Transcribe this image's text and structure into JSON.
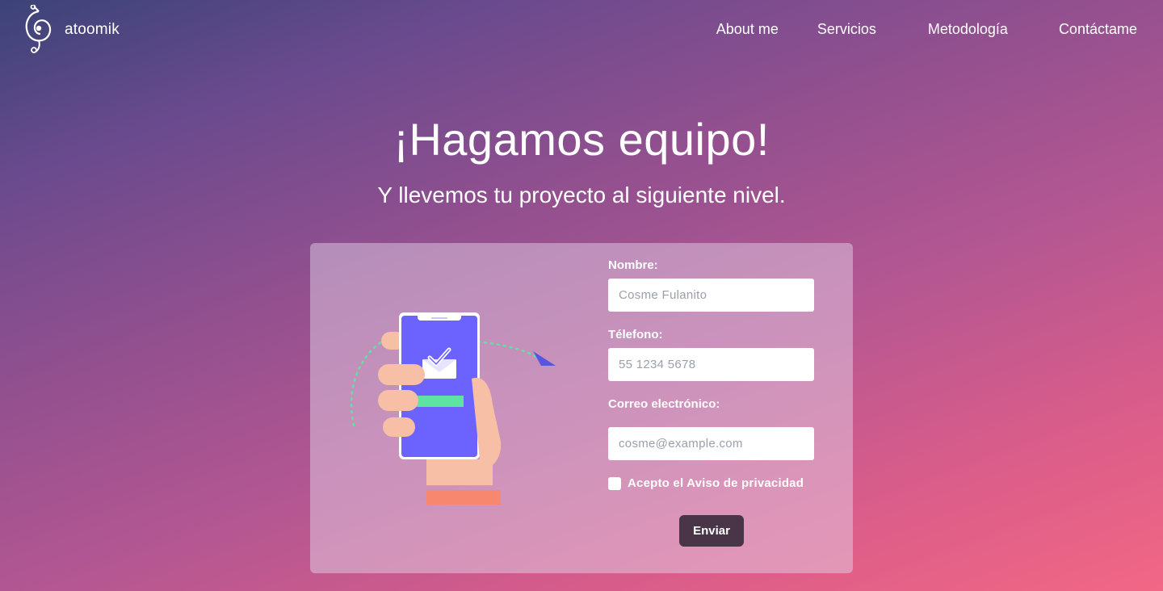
{
  "brand": {
    "name": "atoomik",
    "logo_icon": "atom-spiral-icon"
  },
  "nav": {
    "items": [
      {
        "label": "About me"
      },
      {
        "label": "Servicios"
      },
      {
        "label": "Metodología"
      },
      {
        "label": "Contáctame"
      }
    ]
  },
  "hero": {
    "title": "¡Hagamos equipo!",
    "subtitle": "Y llevemos tu proyecto al siguiente nivel."
  },
  "form": {
    "name_label": "Nombre:",
    "name_placeholder": "Cosme Fulanito",
    "phone_label": "Télefono:",
    "phone_placeholder": "55 1234 5678",
    "email_label": "Correo electrónico:",
    "email_placeholder": "cosme@example.com",
    "privacy_label": "Acepto el Aviso de privacidad",
    "privacy_checked": false,
    "submit_label": "Enviar"
  },
  "illustration": {
    "icon": "phone-hand-message-sent-icon"
  },
  "colors": {
    "gradient_start": "#3b4377",
    "gradient_mid": "#94508f",
    "gradient_end": "#f26785",
    "submit_bg": "#4a3548",
    "phone_screen": "#6c63ff",
    "accent_green": "#5fe3a1",
    "skin": "#f6bfa6",
    "sleeve": "#f7876f"
  }
}
